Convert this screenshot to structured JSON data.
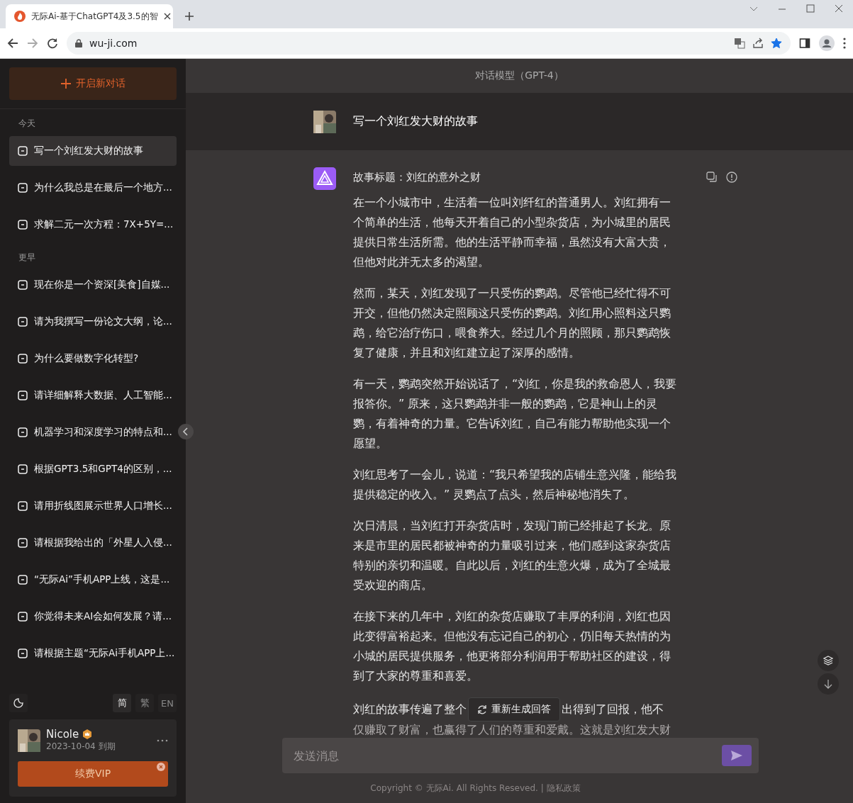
{
  "browser": {
    "tab_title": "无际Ai-基于ChatGPT4及3.5的智",
    "address": "wu-ji.com",
    "bookmarked": true
  },
  "sidebar": {
    "new_chat": "开启新对话",
    "groups": [
      {
        "label": "今天",
        "items": [
          {
            "title": "写一个刘红发大财的故事",
            "selected": true
          },
          {
            "title": "为什么我总是在最后一个地方...",
            "selected": false
          },
          {
            "title": "求解二元一次方程：7X+5Y=...",
            "selected": false
          }
        ]
      },
      {
        "label": "更早",
        "items": [
          {
            "title": "现在你是一个资深[美食]自媒...",
            "selected": false
          },
          {
            "title": "请为我撰写一份论文大纲，论...",
            "selected": false
          },
          {
            "title": "为什么要做数字化转型?",
            "selected": false
          },
          {
            "title": "请详细解释大数据、人工智能...",
            "selected": false
          },
          {
            "title": "机器学习和深度学习的特点和...",
            "selected": false
          },
          {
            "title": "根据GPT3.5和GPT4的区别，...",
            "selected": false
          },
          {
            "title": "请用折线图展示世界人口增长...",
            "selected": false
          },
          {
            "title": "请根据我给出的「外星人入侵...",
            "selected": false
          },
          {
            "title": "“无际Ai”手机APP上线，这是...",
            "selected": false
          },
          {
            "title": "你觉得未来AI会如何发展？请...",
            "selected": false
          },
          {
            "title": "请根据主题“无际Ai手机APP上...",
            "selected": false
          }
        ]
      }
    ],
    "languages": [
      {
        "label": "简",
        "selected": true
      },
      {
        "label": "繁",
        "selected": false
      },
      {
        "label": "EN",
        "selected": false
      }
    ],
    "user": {
      "name": "Nicole",
      "expiry": "2023-10-04 到期",
      "vip_button": "续费VIP"
    }
  },
  "chat": {
    "model_title": "对话模型（GPT-4）",
    "question": "写一个刘红发大财的故事",
    "answer_title": "故事标题：刘红的意外之财",
    "paragraphs": [
      "在一个小城市中，生活着一位叫刘纤红的普通男人。刘红拥有一个简单的生活，他每天开着自己的小型杂货店，为小城里的居民提供日常生活所需。他的生活平静而幸福，虽然没有大富大贵，但他对此并无太多的渴望。",
      "然而，某天，刘红发现了一只受伤的鹦鹉。尽管他已经忙得不可开交，但他仍然决定照顾这只受伤的鹦鹉。刘红用心照料这只鹦鹉，给它治疗伤口，喂食养大。经过几个月的照顾，那只鹦鹉恢复了健康，并且和刘红建立起了深厚的感情。",
      "有一天，鹦鹉突然开始说话了，“刘红，你是我的救命恩人，我要报答你。” 原来，这只鹦鹉并非一般的鹦鹉，它是神山上的灵鹦，有着神奇的力量。它告诉刘红，自己有能力帮助他实现一个愿望。",
      "刘红思考了一会儿，说道：“我只希望我的店铺生意兴隆，能给我提供稳定的收入。” 灵鹦点了点头，然后神秘地消失了。",
      "次日清晨，当刘红打开杂货店时，发现门前已经排起了长龙。原来是市里的居民都被神奇的力量吸引过来，他们感到这家杂货店特别的亲切和温暖。自此以后，刘红的生意火爆，成为了全城最受欢迎的商店。",
      "在接下来的几年中，刘红的杂货店赚取了丰厚的利润，刘红也因此变得富裕起来。但他没有忘记自己的初心，仍旧每天热情的为小城的居民提供服务，他更将部分利润用于帮助社区的建设，得到了大家的尊重和喜爱。"
    ],
    "last_paragraph": {
      "start": "刘红的故事传遍了整个",
      "end": "出得到了回报，他不",
      "faded_line": "仅赚取了财富，也赢得了人们的尊重和爱戴。这就是刘红发大财"
    },
    "regenerate": "重新生成回答",
    "input": {
      "placeholder": "发送消息"
    },
    "footer": {
      "copyright": "Copyright © 无际Ai. All Rights Reseved. |",
      "privacy": "隐私政策"
    }
  }
}
